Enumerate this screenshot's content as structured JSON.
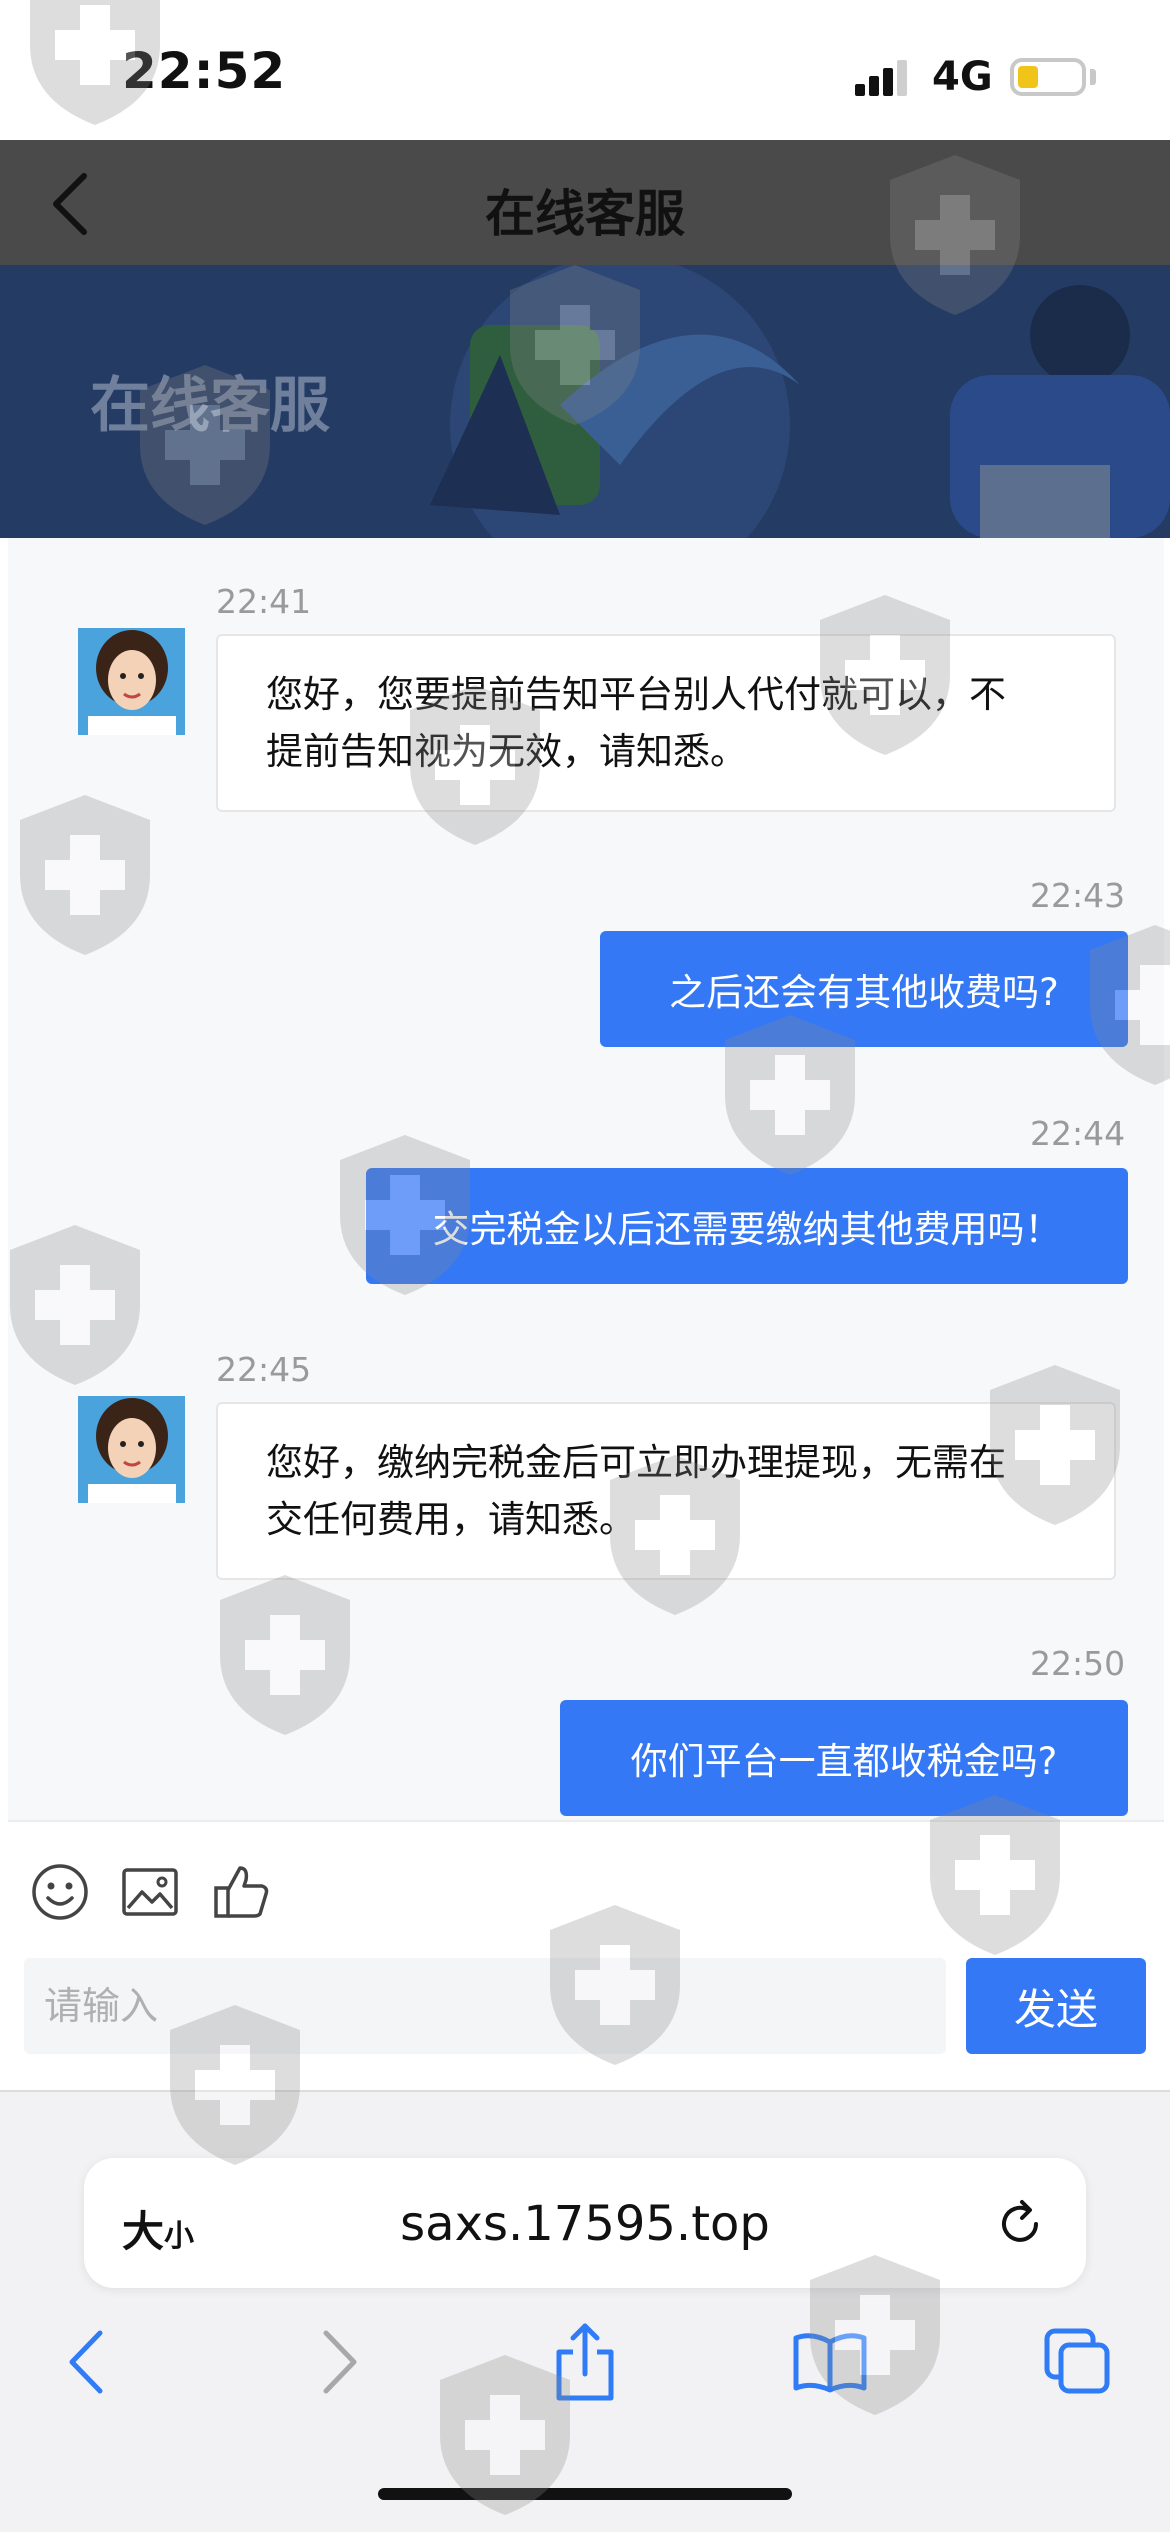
{
  "status_bar": {
    "time": "22:52",
    "network": "4G"
  },
  "header": {
    "title": "在线客服"
  },
  "banner": {
    "title": "在线客服"
  },
  "messages": [
    {
      "time": "22:41",
      "side": "left",
      "lines": [
        "您好，您要提前告知平台别人代付就可以，不",
        "提前告知视为无效，请知悉。"
      ]
    },
    {
      "time": "22:43",
      "side": "right",
      "text": "之后还会有其他收费吗?"
    },
    {
      "time": "22:44",
      "side": "right",
      "text": "交完税金以后还需要缴纳其他费用吗！"
    },
    {
      "time": "22:45",
      "side": "left",
      "lines": [
        "您好，缴纳完税金后可立即办理提现，无需在",
        "交任何费用，请知悉。"
      ]
    },
    {
      "time": "22:50",
      "side": "right",
      "text": "你们平台一直都收税金吗?"
    }
  ],
  "input": {
    "placeholder": "请输入",
    "send_label": "发送"
  },
  "browser": {
    "text_size_big": "大",
    "text_size_small": "小",
    "url": "saxs.17595.top"
  },
  "colors": {
    "accent": "#3478f6",
    "header": "#4a4a4a",
    "banner": "#243b63",
    "battery": "#f0c419"
  }
}
